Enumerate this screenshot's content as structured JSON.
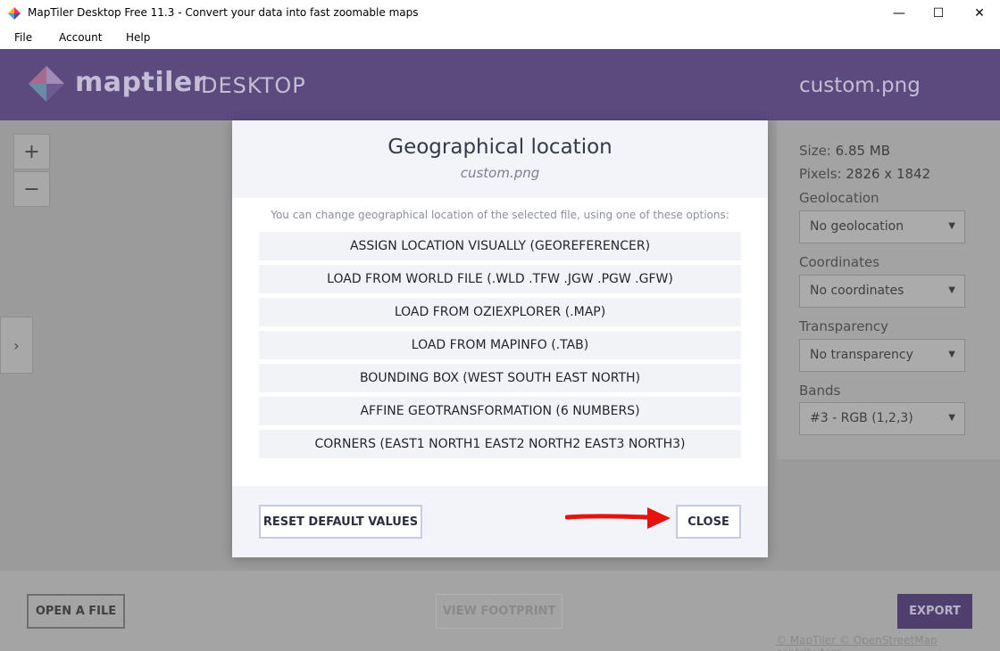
{
  "window": {
    "title": "MapTiler Desktop Free 11.3 - Convert your data into fast zoomable maps",
    "controls": {
      "minimize": "—",
      "maximize": "☐",
      "close": "✕"
    }
  },
  "menu": {
    "items": [
      {
        "label": "File"
      },
      {
        "label": "Account"
      },
      {
        "label": "Help"
      }
    ]
  },
  "header": {
    "brand": "maptiler",
    "brand_suffix": "DESKTOP",
    "filename": "custom.png",
    "color": "#5b4a7e"
  },
  "map_controls": {
    "zoom_in": "+",
    "zoom_out": "−",
    "side_toggle": "›"
  },
  "file_panel": {
    "size_label": "Size:",
    "size_value": "6.85 MB",
    "pixels_label": "Pixels:",
    "pixels_value": "2826 x 1842",
    "geolocation_label": "Geolocation",
    "geolocation_value": "No geolocation",
    "coordinates_label": "Coordinates",
    "coordinates_value": "No coordinates",
    "transparency_label": "Transparency",
    "transparency_value": "No transparency",
    "bands_label": "Bands",
    "bands_value": "#3 - RGB (1,2,3)"
  },
  "dialog": {
    "title": "Geographical location",
    "subtitle": "custom.png",
    "intro": "You can change geographical location of the selected file, using one of these options:",
    "options": [
      "ASSIGN LOCATION VISUALLY (GEOREFERENCER)",
      "LOAD FROM WORLD FILE (.WLD .TFW .JGW .PGW .GFW)",
      "LOAD FROM OZIEXPLORER (.MAP)",
      "LOAD FROM MAPINFO (.TAB)",
      "BOUNDING BOX (WEST SOUTH EAST NORTH)",
      "AFFINE GEOTRANSFORMATION (6 NUMBERS)",
      "CORNERS (EAST1 NORTH1 EAST2 NORTH2 EAST3 NORTH3)"
    ],
    "reset_label": "RESET DEFAULT VALUES",
    "close_label": "CLOSE",
    "annotation_color": "#e8120c"
  },
  "footer": {
    "open_label": "OPEN A FILE",
    "footprint_label": "VIEW FOOTPRINT",
    "export_label": "EXPORT",
    "attribution": "© MapTiler © OpenStreetMap contributors"
  }
}
